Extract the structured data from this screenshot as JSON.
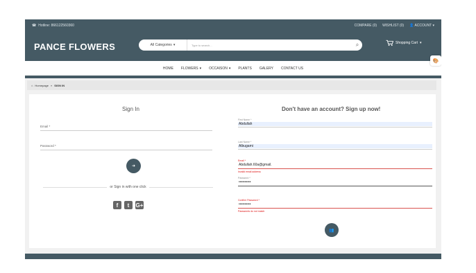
{
  "topbar": {
    "hotline": "Hotline: 866122560360",
    "compare": "COMPARE (0)",
    "wishlist": "WISHLIST (0)",
    "account": "ACCOUNT"
  },
  "header": {
    "logo": "PANCE FLOWERS",
    "category": "All Categories",
    "search_placeholder": "Type to search...",
    "cart": "Shopping Cart"
  },
  "nav": {
    "items": [
      "HOME",
      "FLOWERS",
      "OCCAISON",
      "PLANTS",
      "GALERY",
      "CONTACT US"
    ]
  },
  "breadcrumb": {
    "home": "Homepage",
    "current": "SIGN IN"
  },
  "signin": {
    "title": "Sign In",
    "email_label": "Email *",
    "password_label": "Password *",
    "divider": "or Sign in with one click"
  },
  "signup": {
    "title": "Don't have an account? Sign up now!",
    "first_name_label": "First Name *",
    "first_name": "Abdullah",
    "last_name_label": "Last Name *",
    "last_name": "Albugami",
    "email_label": "Email *",
    "email": "Abdullah.60a@gmail.",
    "email_error": "Invalid email address",
    "password_label": "Password *",
    "password": "••••••••••",
    "confirm_label": "Confirm Password *",
    "confirm": "••••••••••",
    "confirm_error": "Passwords do not match"
  }
}
